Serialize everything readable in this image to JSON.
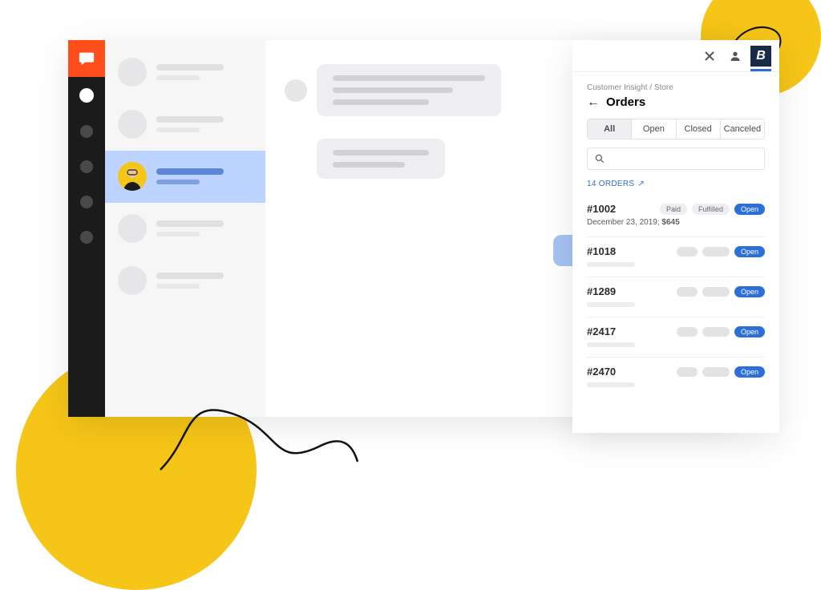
{
  "panel": {
    "breadcrumb": "Customer Insight / Store",
    "title": "Orders",
    "tabs": {
      "all": "All",
      "open": "Open",
      "closed": "Closed",
      "canceled": "Canceled"
    },
    "count_label": "14 ORDERS",
    "orders": [
      {
        "id": "#1002",
        "date": "December 23, 2019;",
        "total": "$645",
        "pills": [
          "Paid",
          "Fulfilled",
          "Open"
        ],
        "detailed": true
      },
      {
        "id": "#1018",
        "open_label": "Open"
      },
      {
        "id": "#1289",
        "open_label": "Open"
      },
      {
        "id": "#2417",
        "open_label": "Open"
      },
      {
        "id": "#2470",
        "open_label": "Open"
      }
    ]
  }
}
